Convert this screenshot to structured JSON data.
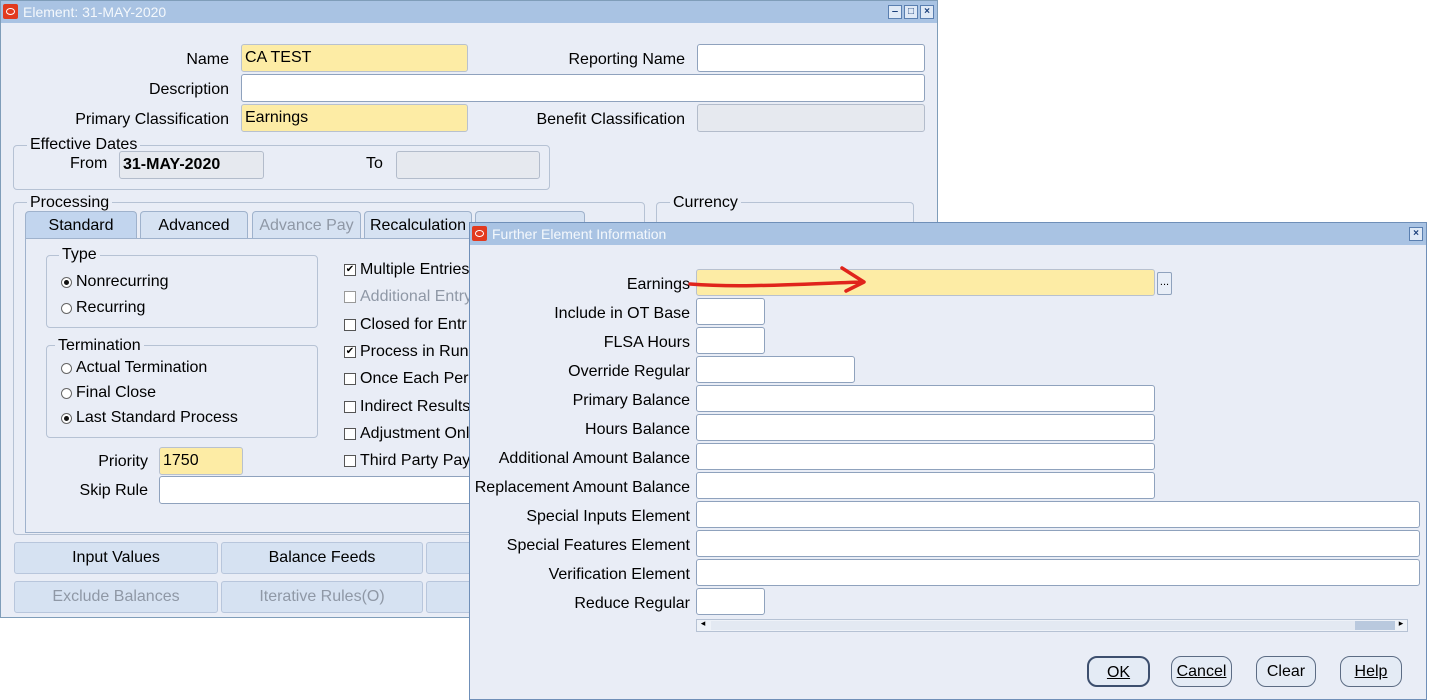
{
  "element_window": {
    "title": "Element: 31-MAY-2020",
    "name_label": "Name",
    "name_value": "CA TEST",
    "reporting_name_label": "Reporting Name",
    "reporting_name_value": "",
    "description_label": "Description",
    "description_value": "",
    "primary_classification_label": "Primary Classification",
    "primary_classification_value": "Earnings",
    "benefit_classification_label": "Benefit Classification",
    "benefit_classification_value": "",
    "effective_dates": {
      "title": "Effective Dates",
      "from_label": "From",
      "from_value": "31-MAY-2020",
      "to_label": "To",
      "to_value": ""
    },
    "processing": {
      "title": "Processing",
      "tabs": [
        "Standard",
        "Advanced",
        "Advance Pay",
        "Recalculation"
      ],
      "type": {
        "title": "Type",
        "options": [
          "Nonrecurring",
          "Recurring"
        ],
        "selected": "Nonrecurring"
      },
      "termination": {
        "title": "Termination",
        "options": [
          "Actual Termination",
          "Final Close",
          "Last Standard Process"
        ],
        "selected": "Last Standard Process"
      },
      "checks": [
        {
          "label": "Multiple Entries",
          "checked": true
        },
        {
          "label": "Additional Entry",
          "checked": false
        },
        {
          "label": "Closed for Entr",
          "checked": false
        },
        {
          "label": "Process in Run",
          "checked": true
        },
        {
          "label": "Once Each Per",
          "checked": false
        },
        {
          "label": "Indirect Results",
          "checked": false
        },
        {
          "label": "Adjustment Only",
          "checked": false
        },
        {
          "label": "Third Party Pay",
          "checked": false
        }
      ],
      "priority_label": "Priority",
      "priority_value": "1750",
      "skip_rule_label": "Skip Rule",
      "skip_rule_value": ""
    },
    "currency_title": "Currency",
    "buttons": [
      "Input Values",
      "Balance Feeds",
      "Exclude Balances",
      "Iterative Rules(O)"
    ]
  },
  "dialog": {
    "title": "Further Element Information",
    "fields": [
      {
        "label": "Earnings",
        "value": ""
      },
      {
        "label": "Include in OT Base",
        "value": ""
      },
      {
        "label": "FLSA Hours",
        "value": ""
      },
      {
        "label": "Override Regular",
        "value": ""
      },
      {
        "label": "Primary Balance",
        "value": ""
      },
      {
        "label": "Hours Balance",
        "value": ""
      },
      {
        "label": "Additional Amount Balance",
        "value": ""
      },
      {
        "label": "Replacement Amount Balance",
        "value": ""
      },
      {
        "label": "Special Inputs Element",
        "value": ""
      },
      {
        "label": "Special Features Element",
        "value": ""
      },
      {
        "label": "Verification Element",
        "value": ""
      },
      {
        "label": "Reduce Regular",
        "value": ""
      }
    ],
    "lov_button": "...",
    "buttons": [
      "OK",
      "Cancel",
      "Clear",
      "Help"
    ]
  },
  "annotation_color": "#e0241b"
}
